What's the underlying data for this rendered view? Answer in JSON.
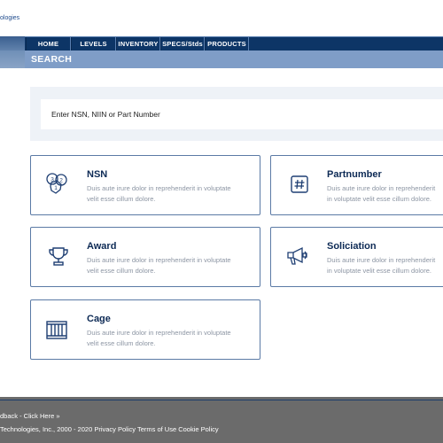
{
  "header": {
    "logo_text": "ologies"
  },
  "nav": {
    "items": [
      "HOME",
      "LEVELS",
      "INVENTORY",
      "SPECS/Stds",
      "PRODUCTS"
    ]
  },
  "search": {
    "title": "SEARCH",
    "placeholder": "Enter NSN, NIIN or Part Number"
  },
  "cards": [
    {
      "title": "NSN",
      "description": "Duis aute irure dolor in reprehenderit in voluptate velit esse cillum dolore.",
      "icon": "badges-icon"
    },
    {
      "title": "Partnumber",
      "description": "Duis aute irure dolor in reprehenderit in voluptate velit esse cillum dolore.",
      "icon": "hashtag-icon"
    },
    {
      "title": "Award",
      "description": "Duis aute irure dolor in reprehenderit in voluptate velit esse cillum dolore.",
      "icon": "trophy-icon"
    },
    {
      "title": "Soliciation",
      "description": "Duis aute irure dolor in reprehenderit in voluptate velit esse cillum dolore.",
      "icon": "megaphone-icon"
    },
    {
      "title": "Cage",
      "description": "Duis aute irure dolor in reprehenderit in voluptate velit esse cillum dolore.",
      "icon": "cage-icon"
    }
  ],
  "footer": {
    "feedback": "dback - Click Here »",
    "copyright": "Technologies, Inc., 2000 - 2020 Privacy Policy Terms of Use Cookie Policy"
  },
  "colors": {
    "nav_bg": "#0d3566",
    "search_header_bg": "#7f9dc7",
    "card_title": "#0d2a55",
    "footer_bg": "#6b6b6b"
  }
}
